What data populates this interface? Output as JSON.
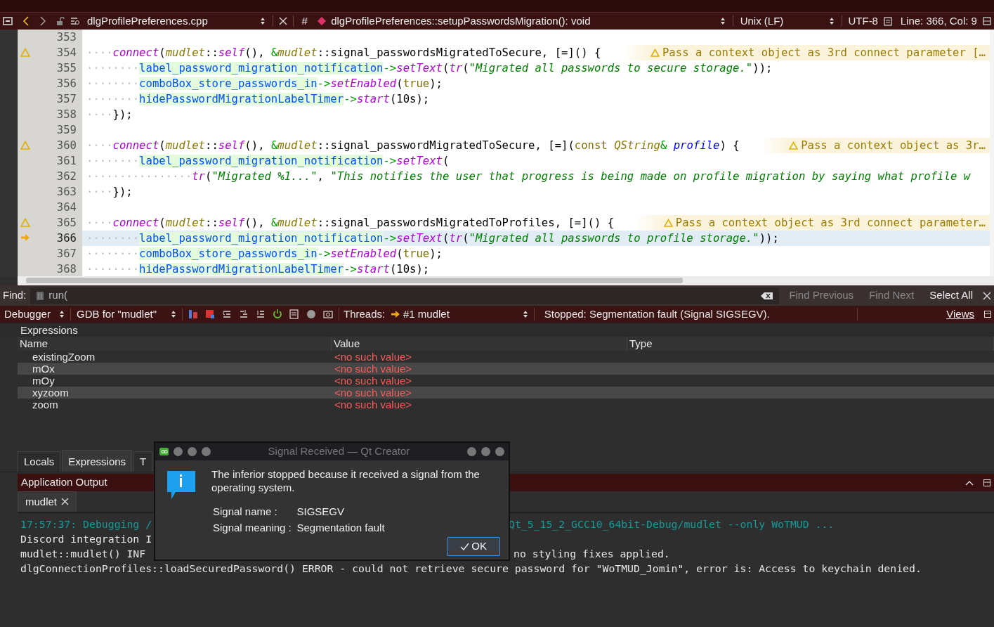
{
  "editor_toolbar": {
    "file": "dlgProfilePreferences.cpp",
    "hash": "#",
    "function": "dlgProfilePreferences::setupPasswordsMigration(): void",
    "line_ending": "Unix (LF)",
    "encoding": "UTF-8",
    "position": "Line: 366, Col: 9"
  },
  "code_lines": [
    {
      "number": "353",
      "warning": false,
      "paused": false,
      "current": false
    },
    {
      "number": "354",
      "warning": true,
      "paused": false,
      "current": false,
      "tokens": [
        {
          "kind": "ws",
          "text": "····"
        },
        {
          "kind": "fn",
          "text": "connect"
        },
        {
          "kind": "plain",
          "text": "("
        },
        {
          "kind": "ns",
          "text": "mudlet"
        },
        {
          "kind": "plain",
          "text": "::"
        },
        {
          "kind": "fn",
          "text": "self"
        },
        {
          "kind": "plain",
          "text": "(), "
        },
        {
          "kind": "op",
          "text": "&"
        },
        {
          "kind": "ns",
          "text": "mudlet"
        },
        {
          "kind": "plain",
          "text": "::signal_passwordsMigratedToSecure, [=]() {"
        }
      ],
      "annotation": "Pass a context object as 3rd connect parameter […"
    },
    {
      "number": "355",
      "warning": false,
      "paused": false,
      "current": false,
      "tokens": [
        {
          "kind": "ws",
          "text": "········"
        },
        {
          "kind": "member",
          "text": "label_password_migration_notification"
        },
        {
          "kind": "op",
          "text": "->"
        },
        {
          "kind": "fn",
          "text": "setText"
        },
        {
          "kind": "plain",
          "text": "("
        },
        {
          "kind": "fn",
          "text": "tr"
        },
        {
          "kind": "plain",
          "text": "("
        },
        {
          "kind": "str",
          "text": "\"Migrated all passwords to secure storage.\""
        },
        {
          "kind": "plain",
          "text": "));"
        }
      ]
    },
    {
      "number": "356",
      "warning": false,
      "paused": false,
      "current": false,
      "tokens": [
        {
          "kind": "ws",
          "text": "········"
        },
        {
          "kind": "member",
          "text": "comboBox_store_passwords_in"
        },
        {
          "kind": "op",
          "text": "->"
        },
        {
          "kind": "fn",
          "text": "setEnabled"
        },
        {
          "kind": "plain",
          "text": "("
        },
        {
          "kind": "kw",
          "text": "true"
        },
        {
          "kind": "plain",
          "text": ");"
        }
      ]
    },
    {
      "number": "357",
      "warning": false,
      "paused": false,
      "current": false,
      "tokens": [
        {
          "kind": "ws",
          "text": "········"
        },
        {
          "kind": "member",
          "text": "hidePasswordMigrationLabelTimer"
        },
        {
          "kind": "op",
          "text": "->"
        },
        {
          "kind": "fn",
          "text": "start"
        },
        {
          "kind": "plain",
          "text": "(10s);"
        }
      ]
    },
    {
      "number": "358",
      "warning": false,
      "paused": false,
      "current": false,
      "tokens": [
        {
          "kind": "ws",
          "text": "····"
        },
        {
          "kind": "plain",
          "text": "});"
        }
      ]
    },
    {
      "number": "359",
      "warning": false,
      "paused": false,
      "current": false
    },
    {
      "number": "360",
      "warning": true,
      "paused": false,
      "current": false,
      "tokens": [
        {
          "kind": "ws",
          "text": "····"
        },
        {
          "kind": "fn",
          "text": "connect"
        },
        {
          "kind": "plain",
          "text": "("
        },
        {
          "kind": "ns",
          "text": "mudlet"
        },
        {
          "kind": "plain",
          "text": "::"
        },
        {
          "kind": "fn",
          "text": "self"
        },
        {
          "kind": "plain",
          "text": "(), "
        },
        {
          "kind": "op",
          "text": "&"
        },
        {
          "kind": "ns",
          "text": "mudlet"
        },
        {
          "kind": "plain",
          "text": "::signal_passwordMigratedToSecure, [=]("
        },
        {
          "kind": "kw",
          "text": "const "
        },
        {
          "kind": "ns",
          "text": "QString"
        },
        {
          "kind": "op",
          "text": "& "
        },
        {
          "kind": "param",
          "text": "profile"
        },
        {
          "kind": "plain",
          "text": ") {"
        }
      ],
      "annotation": "Pass a context object as 3r…"
    },
    {
      "number": "361",
      "warning": false,
      "paused": false,
      "current": false,
      "tokens": [
        {
          "kind": "ws",
          "text": "········"
        },
        {
          "kind": "member",
          "text": "label_password_migration_notification"
        },
        {
          "kind": "op",
          "text": "->"
        },
        {
          "kind": "fn",
          "text": "setText"
        },
        {
          "kind": "plain",
          "text": "("
        }
      ]
    },
    {
      "number": "362",
      "warning": false,
      "paused": false,
      "current": false,
      "tokens": [
        {
          "kind": "ws",
          "text": "················"
        },
        {
          "kind": "fn",
          "text": "tr"
        },
        {
          "kind": "plain",
          "text": "("
        },
        {
          "kind": "str",
          "text": "\"Migrated %1...\""
        },
        {
          "kind": "plain",
          "text": ", "
        },
        {
          "kind": "str",
          "text": "\"This notifies the user that progress is being made on profile migration by saying what profile w"
        }
      ]
    },
    {
      "number": "363",
      "warning": false,
      "paused": false,
      "current": false,
      "tokens": [
        {
          "kind": "ws",
          "text": "····"
        },
        {
          "kind": "plain",
          "text": "});"
        }
      ]
    },
    {
      "number": "364",
      "warning": false,
      "paused": false,
      "current": false
    },
    {
      "number": "365",
      "warning": true,
      "paused": false,
      "current": false,
      "tokens": [
        {
          "kind": "ws",
          "text": "····"
        },
        {
          "kind": "fn",
          "text": "connect"
        },
        {
          "kind": "plain",
          "text": "("
        },
        {
          "kind": "ns",
          "text": "mudlet"
        },
        {
          "kind": "plain",
          "text": "::"
        },
        {
          "kind": "fn",
          "text": "self"
        },
        {
          "kind": "plain",
          "text": "(), "
        },
        {
          "kind": "op",
          "text": "&"
        },
        {
          "kind": "ns",
          "text": "mudlet"
        },
        {
          "kind": "plain",
          "text": "::signal_passwordsMigratedToProfiles, [=]() {"
        }
      ],
      "annotation": "Pass a context object as 3rd connect parameter…"
    },
    {
      "number": "366",
      "warning": false,
      "paused": true,
      "current": true,
      "tokens": [
        {
          "kind": "ws",
          "text": "········"
        },
        {
          "kind": "member",
          "text": "label_password_migration_notification"
        },
        {
          "kind": "op",
          "text": "->"
        },
        {
          "kind": "fn",
          "text": "setText"
        },
        {
          "kind": "plain",
          "text": "("
        },
        {
          "kind": "fn",
          "text": "tr"
        },
        {
          "kind": "plain",
          "text": "("
        },
        {
          "kind": "str",
          "text": "\"Migrated all passwords to profile storage.\""
        },
        {
          "kind": "plain",
          "text": "));"
        }
      ]
    },
    {
      "number": "367",
      "warning": false,
      "paused": false,
      "current": false,
      "tokens": [
        {
          "kind": "ws",
          "text": "········"
        },
        {
          "kind": "member",
          "text": "comboBox_store_passwords_in"
        },
        {
          "kind": "op",
          "text": "->"
        },
        {
          "kind": "fn",
          "text": "setEnabled"
        },
        {
          "kind": "plain",
          "text": "("
        },
        {
          "kind": "kw",
          "text": "true"
        },
        {
          "kind": "plain",
          "text": ");"
        }
      ]
    },
    {
      "number": "368",
      "warning": false,
      "paused": false,
      "current": false,
      "tokens": [
        {
          "kind": "ws",
          "text": "········"
        },
        {
          "kind": "member",
          "text": "hidePasswordMigrationLabelTimer"
        },
        {
          "kind": "op",
          "text": "->"
        },
        {
          "kind": "fn",
          "text": "start"
        },
        {
          "kind": "plain",
          "text": "(10s);"
        }
      ]
    }
  ],
  "find_bar": {
    "label": "Find:",
    "value": "run(",
    "buttons": [
      {
        "label": "Find Previous",
        "enabled": false
      },
      {
        "label": "Find Next",
        "enabled": false
      },
      {
        "label": "Select All",
        "enabled": true
      }
    ]
  },
  "debugger_bar": {
    "mode": "Debugger",
    "engine": "GDB for \"mudlet\"",
    "threads_label": "Threads:",
    "thread": "#1 mudlet",
    "status": "Stopped: Segmentation fault (Signal SIGSEGV).",
    "views": "Views"
  },
  "expressions": {
    "title": "Expressions",
    "columns": [
      "Name",
      "Value",
      "Type"
    ],
    "rows": [
      {
        "name": "existingZoom",
        "value": "<no such value>"
      },
      {
        "name": "mOx",
        "value": "<no such value>"
      },
      {
        "name": "mOy",
        "value": "<no such value>"
      },
      {
        "name": "xyzoom",
        "value": "<no such value>"
      },
      {
        "name": "zoom",
        "value": "<no such value>"
      }
    ]
  },
  "bottom_tabs": [
    {
      "label": "Locals",
      "selected": false
    },
    {
      "label": "Expressions",
      "selected": true
    },
    {
      "label": "T",
      "selected": false
    }
  ],
  "output_pane": {
    "title": "Application Output",
    "tab": "mudlet",
    "lines": [
      {
        "kind": "info",
        "left": "17:57:37: Debugging /",
        "right": "Qt_5_15_2_GCC10_64bit-Debug/mudlet --only WoTMUD ..."
      },
      {
        "kind": "plain",
        "left": "Discord integration I"
      },
      {
        "kind": "plain",
        "left": "mudlet::mudlet() INF",
        "right": "no styling fixes applied."
      },
      {
        "kind": "plain",
        "full": "dlgConnectionProfiles::loadSecuredPassword() ERROR - could not retrieve secure password for \"WoTMUD_Jomin\", error is: Access to keychain denied."
      }
    ]
  },
  "dialog": {
    "title": "Signal Received — Qt Creator",
    "message": "The inferior stopped because it received a signal from the operating system.",
    "fields": [
      {
        "label": "Signal name :",
        "value": "SIGSEGV"
      },
      {
        "label": "Signal meaning :",
        "value": "Segmentation fault"
      }
    ],
    "button": "OK"
  }
}
